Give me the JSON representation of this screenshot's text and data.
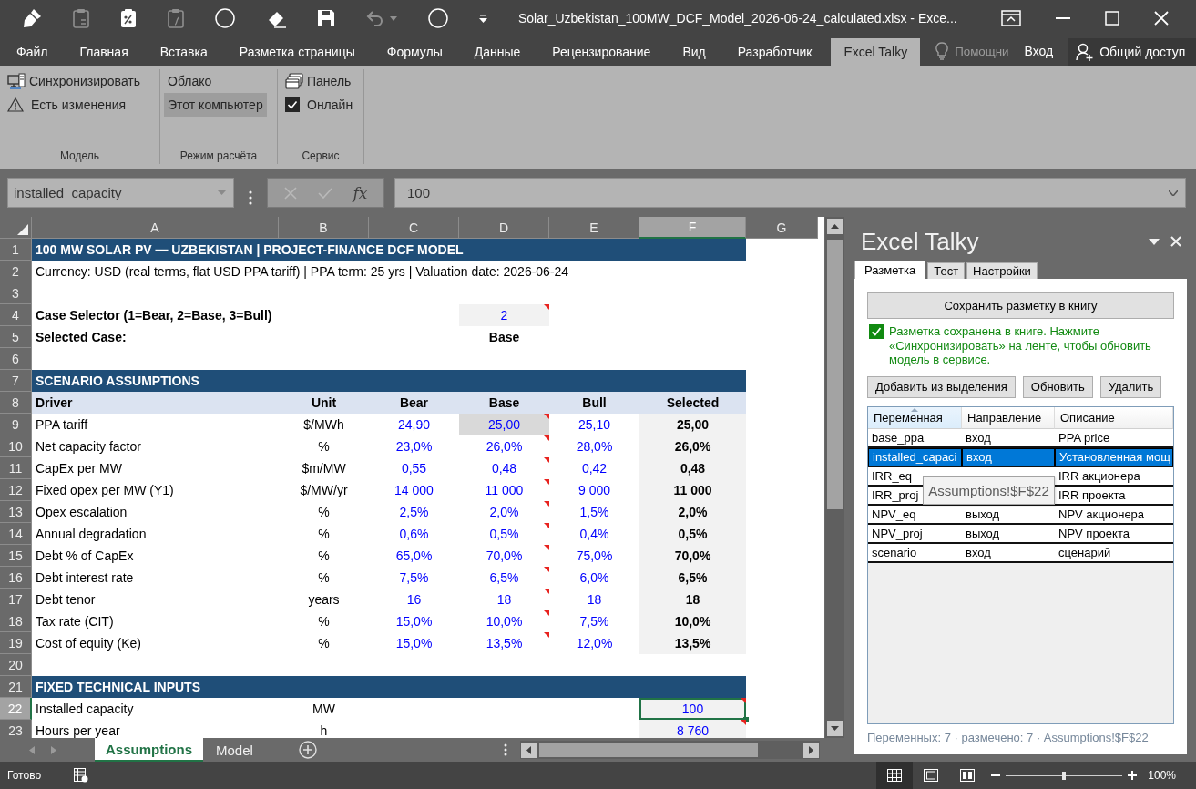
{
  "title_bar": {
    "title": "Solar_Uzbekistan_100MW_DCF_Model_2026-06-24_calculated.xlsx - Exce..."
  },
  "ribbon_tabs": [
    {
      "label": "Файл",
      "selected": false
    },
    {
      "label": "Главная",
      "selected": false
    },
    {
      "label": "Вставка",
      "selected": false
    },
    {
      "label": "Разметка страницы",
      "selected": false
    },
    {
      "label": "Формулы",
      "selected": false
    },
    {
      "label": "Данные",
      "selected": false
    },
    {
      "label": "Рецензирование",
      "selected": false
    },
    {
      "label": "Вид",
      "selected": false
    },
    {
      "label": "Разработчик",
      "selected": false
    },
    {
      "label": "Excel Talky",
      "selected": true
    }
  ],
  "ribbon_right": {
    "tell_me": "Помощни",
    "sign_in": "Вход",
    "share": "Общий доступ"
  },
  "ribbon_groups": [
    {
      "label": "Модель",
      "items": [
        {
          "kind": "sync",
          "label": "Синхронизировать"
        },
        {
          "kind": "warning",
          "label": "Есть изменения"
        }
      ]
    },
    {
      "label": "Режим расчёта",
      "items": [
        {
          "kind": "option",
          "label": "Облако",
          "selected": false
        },
        {
          "kind": "option",
          "label": "Этот компьютер",
          "selected": true
        }
      ]
    },
    {
      "label": "Сервис",
      "items": [
        {
          "kind": "panel",
          "label": "Панель"
        },
        {
          "kind": "checkbox",
          "label": "Онлайн",
          "checked": true
        }
      ]
    }
  ],
  "formula_bar": {
    "name_box": "installed_capacity",
    "function_label": "fx",
    "formula": "100"
  },
  "sheet": {
    "columns": [
      {
        "label": "A",
        "selected": false
      },
      {
        "label": "B",
        "selected": false
      },
      {
        "label": "C",
        "selected": false
      },
      {
        "label": "D",
        "selected": false
      },
      {
        "label": "E",
        "selected": false
      },
      {
        "label": "F",
        "selected": true
      },
      {
        "label": "G",
        "selected": false
      }
    ],
    "rows": [
      {
        "num": "1",
        "selected": false,
        "kind": "band",
        "text": "100 MW SOLAR PV — UZBEKISTAN | PROJECT-FINANCE DCF MODEL"
      },
      {
        "num": "2",
        "selected": false,
        "kind": "plain",
        "cells": [
          {
            "kind": "text",
            "text": "Currency: USD (real terms, flat USD PPA tariff) | PPA term: 25 yrs | Valuation date: 2026-06-24"
          }
        ]
      },
      {
        "num": "3",
        "selected": false,
        "kind": "plain"
      },
      {
        "num": "4",
        "selected": false,
        "kind": "plain",
        "cells": [
          {
            "kind": "bold",
            "text": "Case Selector (1=Bear, 2=Base, 3=Bull)"
          },
          null,
          null,
          {
            "kind": "entry",
            "text": "2",
            "comment": true
          }
        ]
      },
      {
        "num": "5",
        "selected": false,
        "kind": "plain",
        "cells": [
          {
            "kind": "bold",
            "text": "Selected Case:"
          },
          null,
          null,
          {
            "kind": "caption",
            "text": "Base"
          }
        ]
      },
      {
        "num": "6",
        "selected": false,
        "kind": "plain"
      },
      {
        "num": "7",
        "selected": false,
        "kind": "band",
        "text": "SCENARIO ASSUMPTIONS"
      },
      {
        "num": "8",
        "selected": false,
        "kind": "header",
        "cells": [
          "Driver",
          "Unit",
          "Bear",
          "Base",
          "Bull",
          "Selected"
        ]
      },
      {
        "num": "9",
        "selected": false,
        "kind": "plain",
        "cells": [
          {
            "kind": "text",
            "text": "PPA tariff"
          },
          {
            "kind": "unit",
            "text": "$/MWh"
          },
          {
            "kind": "input",
            "text": "24,90",
            "comment": false
          },
          {
            "kind": "shaded",
            "text": "25,00",
            "comment": true
          },
          {
            "kind": "input",
            "text": "25,10",
            "comment": false
          },
          {
            "kind": "result",
            "text": "25,00"
          }
        ]
      },
      {
        "num": "10",
        "selected": false,
        "kind": "plain",
        "cells": [
          {
            "kind": "text",
            "text": "Net capacity factor"
          },
          {
            "kind": "unit",
            "text": "%"
          },
          {
            "kind": "input",
            "text": "23,0%",
            "comment": false
          },
          {
            "kind": "input",
            "text": "26,0%",
            "comment": true
          },
          {
            "kind": "input",
            "text": "28,0%",
            "comment": false
          },
          {
            "kind": "result",
            "text": "26,0%"
          }
        ]
      },
      {
        "num": "11",
        "selected": false,
        "kind": "plain",
        "cells": [
          {
            "kind": "text",
            "text": "CapEx per MW"
          },
          {
            "kind": "unit",
            "text": "$m/MW"
          },
          {
            "kind": "input",
            "text": "0,55",
            "comment": false
          },
          {
            "kind": "input",
            "text": "0,48",
            "comment": true
          },
          {
            "kind": "input",
            "text": "0,42",
            "comment": false
          },
          {
            "kind": "result",
            "text": "0,48"
          }
        ]
      },
      {
        "num": "12",
        "selected": false,
        "kind": "plain",
        "cells": [
          {
            "kind": "text",
            "text": "Fixed opex per MW (Y1)"
          },
          {
            "kind": "unit",
            "text": "$/MW/yr"
          },
          {
            "kind": "input",
            "text": "14 000",
            "comment": false
          },
          {
            "kind": "input",
            "text": "11 000",
            "comment": true
          },
          {
            "kind": "input",
            "text": "9 000",
            "comment": false
          },
          {
            "kind": "result",
            "text": "11 000"
          }
        ]
      },
      {
        "num": "13",
        "selected": false,
        "kind": "plain",
        "cells": [
          {
            "kind": "text",
            "text": "Opex escalation"
          },
          {
            "kind": "unit",
            "text": "%"
          },
          {
            "kind": "input",
            "text": "2,5%",
            "comment": false
          },
          {
            "kind": "input",
            "text": "2,0%",
            "comment": true
          },
          {
            "kind": "input",
            "text": "1,5%",
            "comment": false
          },
          {
            "kind": "result",
            "text": "2,0%"
          }
        ]
      },
      {
        "num": "14",
        "selected": false,
        "kind": "plain",
        "cells": [
          {
            "kind": "text",
            "text": "Annual degradation"
          },
          {
            "kind": "unit",
            "text": "%"
          },
          {
            "kind": "input",
            "text": "0,6%",
            "comment": false
          },
          {
            "kind": "input",
            "text": "0,5%",
            "comment": true
          },
          {
            "kind": "input",
            "text": "0,4%",
            "comment": false
          },
          {
            "kind": "result",
            "text": "0,5%"
          }
        ]
      },
      {
        "num": "15",
        "selected": false,
        "kind": "plain",
        "cells": [
          {
            "kind": "text",
            "text": "Debt % of CapEx"
          },
          {
            "kind": "unit",
            "text": "%"
          },
          {
            "kind": "input",
            "text": "65,0%",
            "comment": false
          },
          {
            "kind": "input",
            "text": "70,0%",
            "comment": true
          },
          {
            "kind": "input",
            "text": "75,0%",
            "comment": false
          },
          {
            "kind": "result",
            "text": "70,0%"
          }
        ]
      },
      {
        "num": "16",
        "selected": false,
        "kind": "plain",
        "cells": [
          {
            "kind": "text",
            "text": "Debt interest rate"
          },
          {
            "kind": "unit",
            "text": "%"
          },
          {
            "kind": "input",
            "text": "7,5%",
            "comment": false
          },
          {
            "kind": "input",
            "text": "6,5%",
            "comment": true
          },
          {
            "kind": "input",
            "text": "6,0%",
            "comment": false
          },
          {
            "kind": "result",
            "text": "6,5%"
          }
        ]
      },
      {
        "num": "17",
        "selected": false,
        "kind": "plain",
        "cells": [
          {
            "kind": "text",
            "text": "Debt tenor"
          },
          {
            "kind": "unit",
            "text": "years"
          },
          {
            "kind": "input",
            "text": "16",
            "comment": false
          },
          {
            "kind": "input",
            "text": "18",
            "comment": true
          },
          {
            "kind": "input",
            "text": "18",
            "comment": false
          },
          {
            "kind": "result",
            "text": "18"
          }
        ]
      },
      {
        "num": "18",
        "selected": false,
        "kind": "plain",
        "cells": [
          {
            "kind": "text",
            "text": "Tax rate (CIT)"
          },
          {
            "kind": "unit",
            "text": "%"
          },
          {
            "kind": "input",
            "text": "15,0%",
            "comment": false
          },
          {
            "kind": "input",
            "text": "10,0%",
            "comment": true
          },
          {
            "kind": "input",
            "text": "7,5%",
            "comment": false
          },
          {
            "kind": "result",
            "text": "10,0%"
          }
        ]
      },
      {
        "num": "19",
        "selected": false,
        "kind": "plain",
        "cells": [
          {
            "kind": "text",
            "text": "Cost of equity (Ke)"
          },
          {
            "kind": "unit",
            "text": "%"
          },
          {
            "kind": "input",
            "text": "15,0%",
            "comment": false
          },
          {
            "kind": "input",
            "text": "13,5%",
            "comment": true
          },
          {
            "kind": "input",
            "text": "12,0%",
            "comment": false
          },
          {
            "kind": "result",
            "text": "13,5%"
          }
        ]
      },
      {
        "num": "20",
        "selected": false,
        "kind": "plain"
      },
      {
        "num": "21",
        "selected": false,
        "kind": "band",
        "text": "FIXED TECHNICAL INPUTS"
      },
      {
        "num": "22",
        "selected": true,
        "kind": "plain",
        "cells": [
          {
            "kind": "text",
            "text": "Installed capacity"
          },
          {
            "kind": "unit",
            "text": "MW"
          },
          null,
          null,
          null,
          {
            "kind": "entry",
            "text": "100",
            "comment": true
          }
        ]
      },
      {
        "num": "23",
        "selected": false,
        "kind": "plain",
        "cells": [
          {
            "kind": "text",
            "text": "Hours per year"
          },
          {
            "kind": "unit",
            "text": "h"
          },
          null,
          null,
          null,
          {
            "kind": "entry",
            "text": "8 760",
            "comment": true
          }
        ]
      }
    ]
  },
  "sheet_tabs": [
    {
      "label": "Assumptions",
      "selected": true
    },
    {
      "label": "Model",
      "selected": false
    }
  ],
  "task_pane": {
    "title": "Excel Talky",
    "tabs": [
      {
        "label": "Разметка",
        "selected": true
      },
      {
        "label": "Тест",
        "selected": false
      },
      {
        "label": "Настройки",
        "selected": false
      }
    ],
    "save_button": "Сохранить разметку в книгу",
    "message": {
      "saved": true,
      "text": "Разметка сохранена в книге. Нажмите «Синхронизировать» на ленте, чтобы обновить модель в сервисе."
    },
    "actions": [
      "Добавить из выделения",
      "Обновить",
      "Удалить"
    ],
    "table": {
      "columns": [
        {
          "label": "Переменная",
          "sorted": true
        },
        {
          "label": "Направление",
          "sorted": false
        },
        {
          "label": "Описание",
          "sorted": false
        }
      ],
      "rows": [
        {
          "variable": "base_ppa",
          "direction": "вход",
          "description": "PPA price",
          "selected": false
        },
        {
          "variable": "installed_capaci",
          "direction": "вход",
          "description": "Установленная мощ",
          "selected": true
        },
        {
          "variable": "IRR_eq",
          "description": "IRR акционера",
          "selected": false
        },
        {
          "variable": "IRR_proj",
          "description": "IRR проекта",
          "selected": false
        },
        {
          "variable": "NPV_eq",
          "direction": "выход",
          "description": "NPV акционера",
          "selected": false
        },
        {
          "variable": "NPV_proj",
          "direction": "выход",
          "description": "NPV проекта",
          "selected": false
        },
        {
          "variable": "scenario",
          "direction": "вход",
          "description": "сценарий",
          "selected": false
        }
      ]
    },
    "tooltip": "Assumptions!$F$22",
    "footer": "Переменных: 7 · размечено: 7 · Assumptions!$F$22"
  },
  "status_bar": {
    "status": "Готово",
    "views": [
      {
        "kind": "normal",
        "selected": true
      },
      {
        "kind": "layout",
        "selected": false
      },
      {
        "kind": "breaks",
        "selected": false
      }
    ],
    "zoom": {
      "label": "100%",
      "level": 0.5
    }
  }
}
